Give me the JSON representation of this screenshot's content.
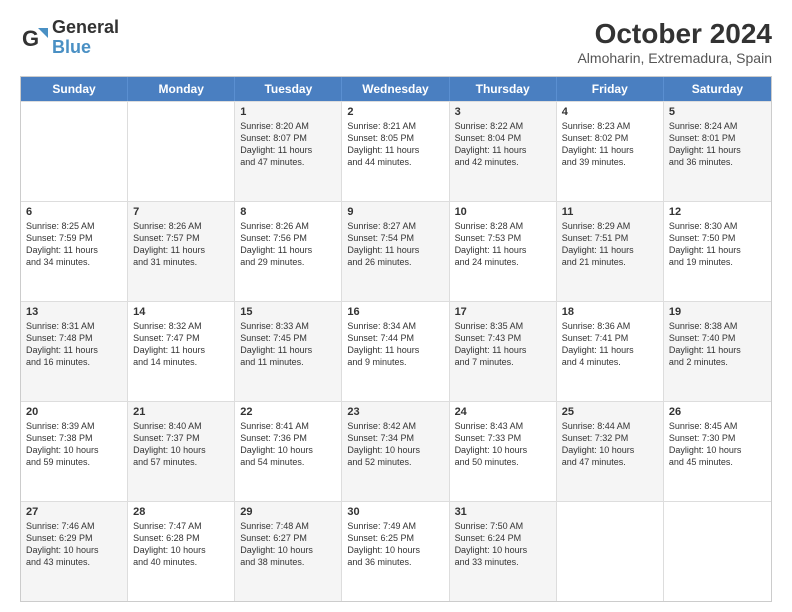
{
  "logo": {
    "line1": "General",
    "line2": "Blue"
  },
  "title": "October 2024",
  "location": "Almoharin, Extremadura, Spain",
  "weekdays": [
    "Sunday",
    "Monday",
    "Tuesday",
    "Wednesday",
    "Thursday",
    "Friday",
    "Saturday"
  ],
  "rows": [
    [
      {
        "day": "",
        "lines": [],
        "shaded": false
      },
      {
        "day": "",
        "lines": [],
        "shaded": false
      },
      {
        "day": "1",
        "lines": [
          "Sunrise: 8:20 AM",
          "Sunset: 8:07 PM",
          "Daylight: 11 hours",
          "and 47 minutes."
        ],
        "shaded": true
      },
      {
        "day": "2",
        "lines": [
          "Sunrise: 8:21 AM",
          "Sunset: 8:05 PM",
          "Daylight: 11 hours",
          "and 44 minutes."
        ],
        "shaded": false
      },
      {
        "day": "3",
        "lines": [
          "Sunrise: 8:22 AM",
          "Sunset: 8:04 PM",
          "Daylight: 11 hours",
          "and 42 minutes."
        ],
        "shaded": true
      },
      {
        "day": "4",
        "lines": [
          "Sunrise: 8:23 AM",
          "Sunset: 8:02 PM",
          "Daylight: 11 hours",
          "and 39 minutes."
        ],
        "shaded": false
      },
      {
        "day": "5",
        "lines": [
          "Sunrise: 8:24 AM",
          "Sunset: 8:01 PM",
          "Daylight: 11 hours",
          "and 36 minutes."
        ],
        "shaded": true
      }
    ],
    [
      {
        "day": "6",
        "lines": [
          "Sunrise: 8:25 AM",
          "Sunset: 7:59 PM",
          "Daylight: 11 hours",
          "and 34 minutes."
        ],
        "shaded": false
      },
      {
        "day": "7",
        "lines": [
          "Sunrise: 8:26 AM",
          "Sunset: 7:57 PM",
          "Daylight: 11 hours",
          "and 31 minutes."
        ],
        "shaded": true
      },
      {
        "day": "8",
        "lines": [
          "Sunrise: 8:26 AM",
          "Sunset: 7:56 PM",
          "Daylight: 11 hours",
          "and 29 minutes."
        ],
        "shaded": false
      },
      {
        "day": "9",
        "lines": [
          "Sunrise: 8:27 AM",
          "Sunset: 7:54 PM",
          "Daylight: 11 hours",
          "and 26 minutes."
        ],
        "shaded": true
      },
      {
        "day": "10",
        "lines": [
          "Sunrise: 8:28 AM",
          "Sunset: 7:53 PM",
          "Daylight: 11 hours",
          "and 24 minutes."
        ],
        "shaded": false
      },
      {
        "day": "11",
        "lines": [
          "Sunrise: 8:29 AM",
          "Sunset: 7:51 PM",
          "Daylight: 11 hours",
          "and 21 minutes."
        ],
        "shaded": true
      },
      {
        "day": "12",
        "lines": [
          "Sunrise: 8:30 AM",
          "Sunset: 7:50 PM",
          "Daylight: 11 hours",
          "and 19 minutes."
        ],
        "shaded": false
      }
    ],
    [
      {
        "day": "13",
        "lines": [
          "Sunrise: 8:31 AM",
          "Sunset: 7:48 PM",
          "Daylight: 11 hours",
          "and 16 minutes."
        ],
        "shaded": true
      },
      {
        "day": "14",
        "lines": [
          "Sunrise: 8:32 AM",
          "Sunset: 7:47 PM",
          "Daylight: 11 hours",
          "and 14 minutes."
        ],
        "shaded": false
      },
      {
        "day": "15",
        "lines": [
          "Sunrise: 8:33 AM",
          "Sunset: 7:45 PM",
          "Daylight: 11 hours",
          "and 11 minutes."
        ],
        "shaded": true
      },
      {
        "day": "16",
        "lines": [
          "Sunrise: 8:34 AM",
          "Sunset: 7:44 PM",
          "Daylight: 11 hours",
          "and 9 minutes."
        ],
        "shaded": false
      },
      {
        "day": "17",
        "lines": [
          "Sunrise: 8:35 AM",
          "Sunset: 7:43 PM",
          "Daylight: 11 hours",
          "and 7 minutes."
        ],
        "shaded": true
      },
      {
        "day": "18",
        "lines": [
          "Sunrise: 8:36 AM",
          "Sunset: 7:41 PM",
          "Daylight: 11 hours",
          "and 4 minutes."
        ],
        "shaded": false
      },
      {
        "day": "19",
        "lines": [
          "Sunrise: 8:38 AM",
          "Sunset: 7:40 PM",
          "Daylight: 11 hours",
          "and 2 minutes."
        ],
        "shaded": true
      }
    ],
    [
      {
        "day": "20",
        "lines": [
          "Sunrise: 8:39 AM",
          "Sunset: 7:38 PM",
          "Daylight: 10 hours",
          "and 59 minutes."
        ],
        "shaded": false
      },
      {
        "day": "21",
        "lines": [
          "Sunrise: 8:40 AM",
          "Sunset: 7:37 PM",
          "Daylight: 10 hours",
          "and 57 minutes."
        ],
        "shaded": true
      },
      {
        "day": "22",
        "lines": [
          "Sunrise: 8:41 AM",
          "Sunset: 7:36 PM",
          "Daylight: 10 hours",
          "and 54 minutes."
        ],
        "shaded": false
      },
      {
        "day": "23",
        "lines": [
          "Sunrise: 8:42 AM",
          "Sunset: 7:34 PM",
          "Daylight: 10 hours",
          "and 52 minutes."
        ],
        "shaded": true
      },
      {
        "day": "24",
        "lines": [
          "Sunrise: 8:43 AM",
          "Sunset: 7:33 PM",
          "Daylight: 10 hours",
          "and 50 minutes."
        ],
        "shaded": false
      },
      {
        "day": "25",
        "lines": [
          "Sunrise: 8:44 AM",
          "Sunset: 7:32 PM",
          "Daylight: 10 hours",
          "and 47 minutes."
        ],
        "shaded": true
      },
      {
        "day": "26",
        "lines": [
          "Sunrise: 8:45 AM",
          "Sunset: 7:30 PM",
          "Daylight: 10 hours",
          "and 45 minutes."
        ],
        "shaded": false
      }
    ],
    [
      {
        "day": "27",
        "lines": [
          "Sunrise: 7:46 AM",
          "Sunset: 6:29 PM",
          "Daylight: 10 hours",
          "and 43 minutes."
        ],
        "shaded": true
      },
      {
        "day": "28",
        "lines": [
          "Sunrise: 7:47 AM",
          "Sunset: 6:28 PM",
          "Daylight: 10 hours",
          "and 40 minutes."
        ],
        "shaded": false
      },
      {
        "day": "29",
        "lines": [
          "Sunrise: 7:48 AM",
          "Sunset: 6:27 PM",
          "Daylight: 10 hours",
          "and 38 minutes."
        ],
        "shaded": true
      },
      {
        "day": "30",
        "lines": [
          "Sunrise: 7:49 AM",
          "Sunset: 6:25 PM",
          "Daylight: 10 hours",
          "and 36 minutes."
        ],
        "shaded": false
      },
      {
        "day": "31",
        "lines": [
          "Sunrise: 7:50 AM",
          "Sunset: 6:24 PM",
          "Daylight: 10 hours",
          "and 33 minutes."
        ],
        "shaded": true
      },
      {
        "day": "",
        "lines": [],
        "shaded": false
      },
      {
        "day": "",
        "lines": [],
        "shaded": false
      }
    ]
  ]
}
